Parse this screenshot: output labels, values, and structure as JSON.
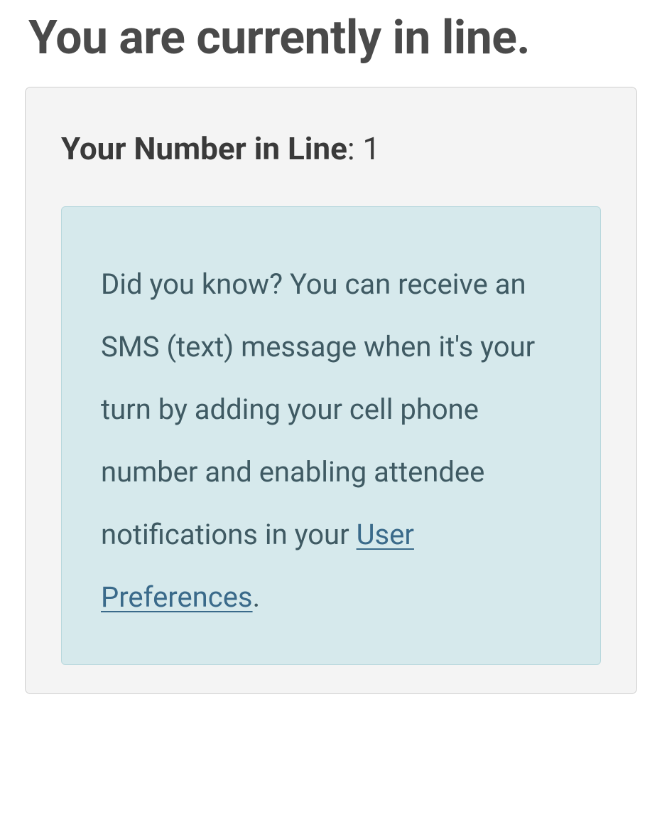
{
  "header": {
    "title": "You are currently in line."
  },
  "status": {
    "line_number_label": "Your Number in Line",
    "line_number_value": "1"
  },
  "info": {
    "message_before_link": "Did you know? You can receive an SMS (text) message when it's your turn by adding your cell phone number and enabling attendee notifications in your ",
    "link_text": "User Preferences",
    "message_after_link": "."
  }
}
